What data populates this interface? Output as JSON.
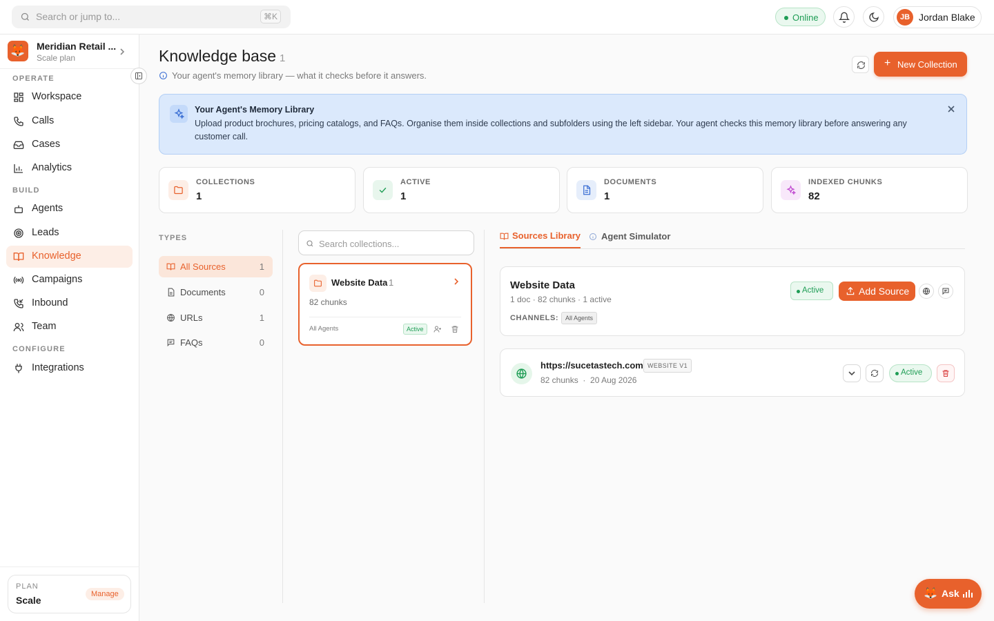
{
  "topbar": {
    "search_placeholder": "Search or jump to...",
    "search_shortcut": "⌘K",
    "status": "Online",
    "user_initials": "JB",
    "user_name": "Jordan Blake"
  },
  "sidebar": {
    "org_name": "Meridian Retail ...",
    "org_plan": "Scale plan",
    "sections": {
      "operate": "OPERATE",
      "build": "BUILD",
      "configure": "CONFIGURE"
    },
    "items": [
      {
        "label": "Workspace",
        "icon": "grid-icon"
      },
      {
        "label": "Calls",
        "icon": "phone-icon"
      },
      {
        "label": "Cases",
        "icon": "inbox-icon"
      },
      {
        "label": "Analytics",
        "icon": "bar-chart-icon"
      },
      {
        "label": "Agents",
        "icon": "bot-icon"
      },
      {
        "label": "Leads",
        "icon": "target-icon"
      },
      {
        "label": "Knowledge",
        "icon": "book-icon",
        "active": true
      },
      {
        "label": "Campaigns",
        "icon": "broadcast-icon"
      },
      {
        "label": "Inbound",
        "icon": "phone-incoming-icon"
      },
      {
        "label": "Team",
        "icon": "users-icon"
      },
      {
        "label": "Integrations",
        "icon": "plug-icon"
      }
    ],
    "plan_label": "PLAN",
    "plan_value": "Scale",
    "manage_label": "Manage"
  },
  "header": {
    "title": "Knowledge base",
    "count": "1",
    "subtitle": "Your agent's memory library — what it checks before it answers.",
    "new_collection_label": "New Collection"
  },
  "banner": {
    "title": "Your Agent's Memory Library",
    "text": "Upload product brochures, pricing catalogs, and FAQs. Organise them inside collections and subfolders using the left sidebar. Your agent checks this memory library before answering any customer call."
  },
  "stats": [
    {
      "label": "COLLECTIONS",
      "value": "1",
      "icon": "folder-icon",
      "color": "#e8612c"
    },
    {
      "label": "ACTIVE",
      "value": "1",
      "icon": "check-icon",
      "color": "#1e9d55"
    },
    {
      "label": "DOCUMENTS",
      "value": "1",
      "icon": "document-icon",
      "color": "#3b6fd4"
    },
    {
      "label": "INDEXED CHUNKS",
      "value": "82",
      "icon": "sparkles-icon",
      "color": "#c04ad0"
    }
  ],
  "types": {
    "heading": "TYPES",
    "items": [
      {
        "label": "All Sources",
        "count": "1",
        "icon": "book-icon",
        "active": true
      },
      {
        "label": "Documents",
        "count": "0",
        "icon": "document-icon"
      },
      {
        "label": "URLs",
        "count": "1",
        "icon": "globe-icon"
      },
      {
        "label": "FAQs",
        "count": "0",
        "icon": "message-icon"
      }
    ]
  },
  "collections": {
    "search_placeholder": "Search collections...",
    "items": [
      {
        "name": "Website Data",
        "count": "1",
        "chunks": "82 chunks",
        "agents": "All Agents",
        "status": "Active"
      }
    ]
  },
  "tabs": {
    "sources_library": "Sources Library",
    "agent_simulator": "Agent Simulator"
  },
  "collection_panel": {
    "name": "Website Data",
    "meta": "1 doc · 82 chunks · 1 active",
    "status": "Active",
    "add_source_label": "Add Source",
    "channels_label": "CHANNELS:",
    "channel_tag": "All Agents"
  },
  "sources": [
    {
      "url": "https://sucetastech.com",
      "badge": "WEBSITE V1",
      "chunks": "82 chunks",
      "separator": "·",
      "date": "20 Aug 2026",
      "status": "Active"
    }
  ],
  "ask": {
    "label": "Ask"
  },
  "colors": {
    "accent": "#e8612c",
    "success": "#1e9d55",
    "info_bg": "#dbe9fc"
  }
}
